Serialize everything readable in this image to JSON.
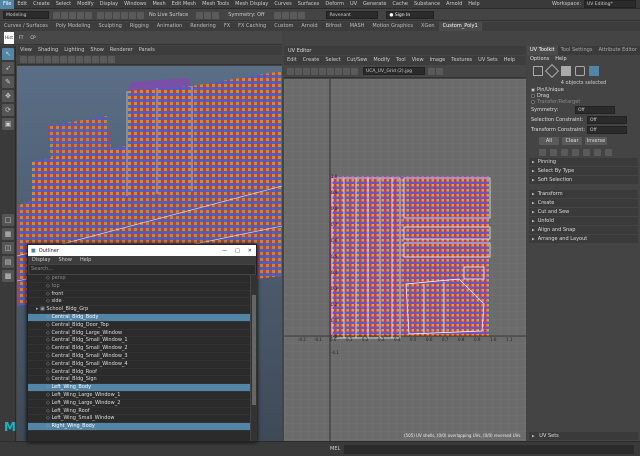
{
  "menubar": {
    "items": [
      "File",
      "Edit",
      "Create",
      "Select",
      "Modify",
      "Display",
      "Windows",
      "Mesh",
      "Edit Mesh",
      "Mesh Tools",
      "Mesh Display",
      "Curves",
      "Surfaces",
      "Deform",
      "UV",
      "Generate",
      "Cache",
      "Substance",
      "Arnold",
      "Help"
    ],
    "workspace_label": "Workspace:",
    "workspace_value": "UV Editing*"
  },
  "statusline": {
    "mode": "Modeling",
    "no_live_surface": "No Live Surface",
    "symmetry": "Symmetry: Off",
    "search_value": "Revenant",
    "sign_in": "Sign In"
  },
  "shelf": {
    "tabs": [
      "Curves / Surfaces",
      "Poly Modeling",
      "Sculpting",
      "Rigging",
      "Animation",
      "Rendering",
      "FX",
      "FX Caching",
      "Custom",
      "Arnold",
      "Bifrost",
      "MASH",
      "Motion Graphics",
      "XGen",
      "Custom_Poly1"
    ],
    "active_tab": 14,
    "icon_labels": [
      "Hist",
      "FT",
      "CP"
    ]
  },
  "viewport": {
    "menu": [
      "View",
      "Shading",
      "Lighting",
      "Show",
      "Renderer",
      "Panels"
    ]
  },
  "uv_editor": {
    "title": "UV Editor",
    "menu": [
      "Edit",
      "Create",
      "Select",
      "Cut/Sew",
      "Modify",
      "Tool",
      "View",
      "Image",
      "Textures",
      "UV Sets",
      "Help"
    ],
    "texture_dropdown": "UCA_UV_Grid (2).jpg",
    "v_ticks": [
      "1.0",
      "0.9",
      "0.8",
      "0.7",
      "0.6",
      "0.5",
      "0.4",
      "0.3",
      "0.2",
      "0.1",
      "0.0",
      "-0.1"
    ],
    "u_ticks": [
      "-0.2",
      "-0.1",
      "0.0",
      "0.1",
      "0.2",
      "0.3",
      "0.4",
      "0.5",
      "0.6",
      "0.7",
      "0.8",
      "0.9",
      "1.0",
      "1.1"
    ],
    "status_text": "(505) UV shells, (0/0) overlapping UVs, (0/0) reversed UVs"
  },
  "uv_toolkit": {
    "tabs": [
      "UV Toolkit",
      "Tool Settings",
      "Attribute Editor"
    ],
    "menu": [
      "Options",
      "Help"
    ],
    "selected_count": "4 objects selected",
    "radio_pin_unpin": "Pin/Unique",
    "radio_drag": "Drag",
    "radio_transfer": "Transfer/Retarget",
    "symmetry_label": "Symmetry:",
    "symmetry_value": "Off",
    "selection_constraint_label": "Selection Constraint:",
    "selection_constraint_value": "Off",
    "transform_constraint_label": "Transform Constraint:",
    "transform_constraint_value": "Off",
    "btn_all": "All",
    "btn_clear": "Clear",
    "btn_inverse": "Inverse",
    "sections": [
      "Pinning",
      "Select By Type",
      "Soft Selection",
      "Transform",
      "Create",
      "Cut and Sew",
      "Unfold",
      "Align and Snap",
      "Arrange and Layout"
    ],
    "uv_sets": "UV Sets"
  },
  "bottombar": {
    "mel_label": "MEL"
  },
  "outliner": {
    "title": "Outliner",
    "menu": [
      "Display",
      "Show",
      "Help"
    ],
    "search_placeholder": "Search...",
    "rows": [
      {
        "label": "persp",
        "indent": 1,
        "state": "dim"
      },
      {
        "label": "top",
        "indent": 1,
        "state": "dim"
      },
      {
        "label": "front",
        "indent": 1,
        "state": ""
      },
      {
        "label": "side",
        "indent": 1,
        "state": ""
      },
      {
        "label": "School_Bldg_Grp",
        "indent": 0,
        "state": ""
      },
      {
        "label": "Central_Bldg_Body",
        "indent": 1,
        "state": "sel"
      },
      {
        "label": "Central_Bldg_Door_Top",
        "indent": 1,
        "state": ""
      },
      {
        "label": "Central_Bldg_Large_Window",
        "indent": 1,
        "state": ""
      },
      {
        "label": "Central_Bldg_Small_Window_1",
        "indent": 1,
        "state": ""
      },
      {
        "label": "Central_Bldg_Small_Window_2",
        "indent": 1,
        "state": ""
      },
      {
        "label": "Central_Bldg_Small_Window_3",
        "indent": 1,
        "state": ""
      },
      {
        "label": "Central_Bldg_Small_Window_4",
        "indent": 1,
        "state": ""
      },
      {
        "label": "Central_Bldg_Roof",
        "indent": 1,
        "state": ""
      },
      {
        "label": "Central_Bldg_Sign",
        "indent": 1,
        "state": ""
      },
      {
        "label": "Left_Wing_Body",
        "indent": 1,
        "state": "sel"
      },
      {
        "label": "Left_Wing_Large_Window_1",
        "indent": 1,
        "state": ""
      },
      {
        "label": "Left_Wing_Large_Window_2",
        "indent": 1,
        "state": ""
      },
      {
        "label": "Left_Wing_Roof",
        "indent": 1,
        "state": ""
      },
      {
        "label": "Left_Wing_Small_Window",
        "indent": 1,
        "state": ""
      },
      {
        "label": "Right_Wing_Body",
        "indent": 1,
        "state": "sel"
      }
    ]
  },
  "colors": {
    "accent": "#5285a6",
    "panel": "#444444",
    "checker_a": "#c93b3b",
    "checker_b": "#3b5bc9"
  }
}
